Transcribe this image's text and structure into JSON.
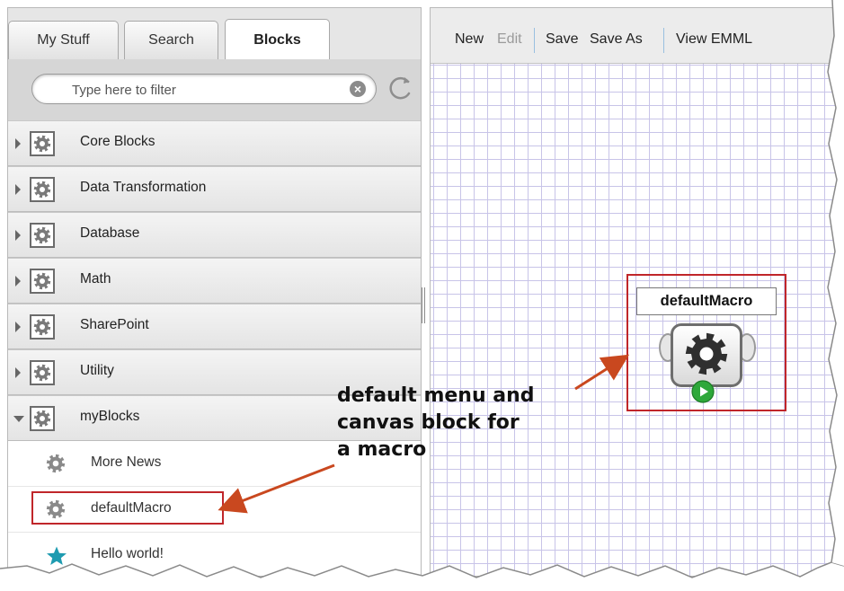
{
  "left_panel": {
    "tabs": [
      {
        "label": "My Stuff"
      },
      {
        "label": "Search"
      },
      {
        "label": "Blocks",
        "active": true
      }
    ],
    "filter": {
      "placeholder": "Type here to filter",
      "value": ""
    },
    "icons": {
      "clear": "clear-circle-icon",
      "refresh": "refresh-icon",
      "gear": "gear-icon",
      "star": "star-icon"
    },
    "categories": [
      {
        "label": "Core Blocks",
        "expanded": false
      },
      {
        "label": "Data Transformation",
        "expanded": false
      },
      {
        "label": "Database",
        "expanded": false
      },
      {
        "label": "Math",
        "expanded": false
      },
      {
        "label": "SharePoint",
        "expanded": false
      },
      {
        "label": "Utility",
        "expanded": false
      },
      {
        "label": "myBlocks",
        "expanded": true
      }
    ],
    "my_blocks": [
      {
        "label": "More News",
        "icon": "gear-icon"
      },
      {
        "label": "defaultMacro",
        "icon": "gear-icon",
        "highlighted": true
      },
      {
        "label": "Hello world!",
        "icon": "star-icon"
      }
    ]
  },
  "toolbar": {
    "new_label": "New",
    "edit_label": "Edit",
    "save_label": "Save",
    "save_as_label": "Save As",
    "view_emml_label": "View EMML"
  },
  "canvas": {
    "block": {
      "title": "defaultMacro",
      "icon": "gear-icon",
      "run_icon": "play-icon"
    }
  },
  "annotation": {
    "lines": [
      "default menu and",
      "canvas block for",
      "a macro"
    ]
  },
  "colors": {
    "highlight_red": "#c0262a",
    "arrow": "#c9481f",
    "grid": "#c8c4e8",
    "star": "#1e9bb0",
    "play": "#2ea83a",
    "toolbar_separator": "#99c0e0"
  }
}
